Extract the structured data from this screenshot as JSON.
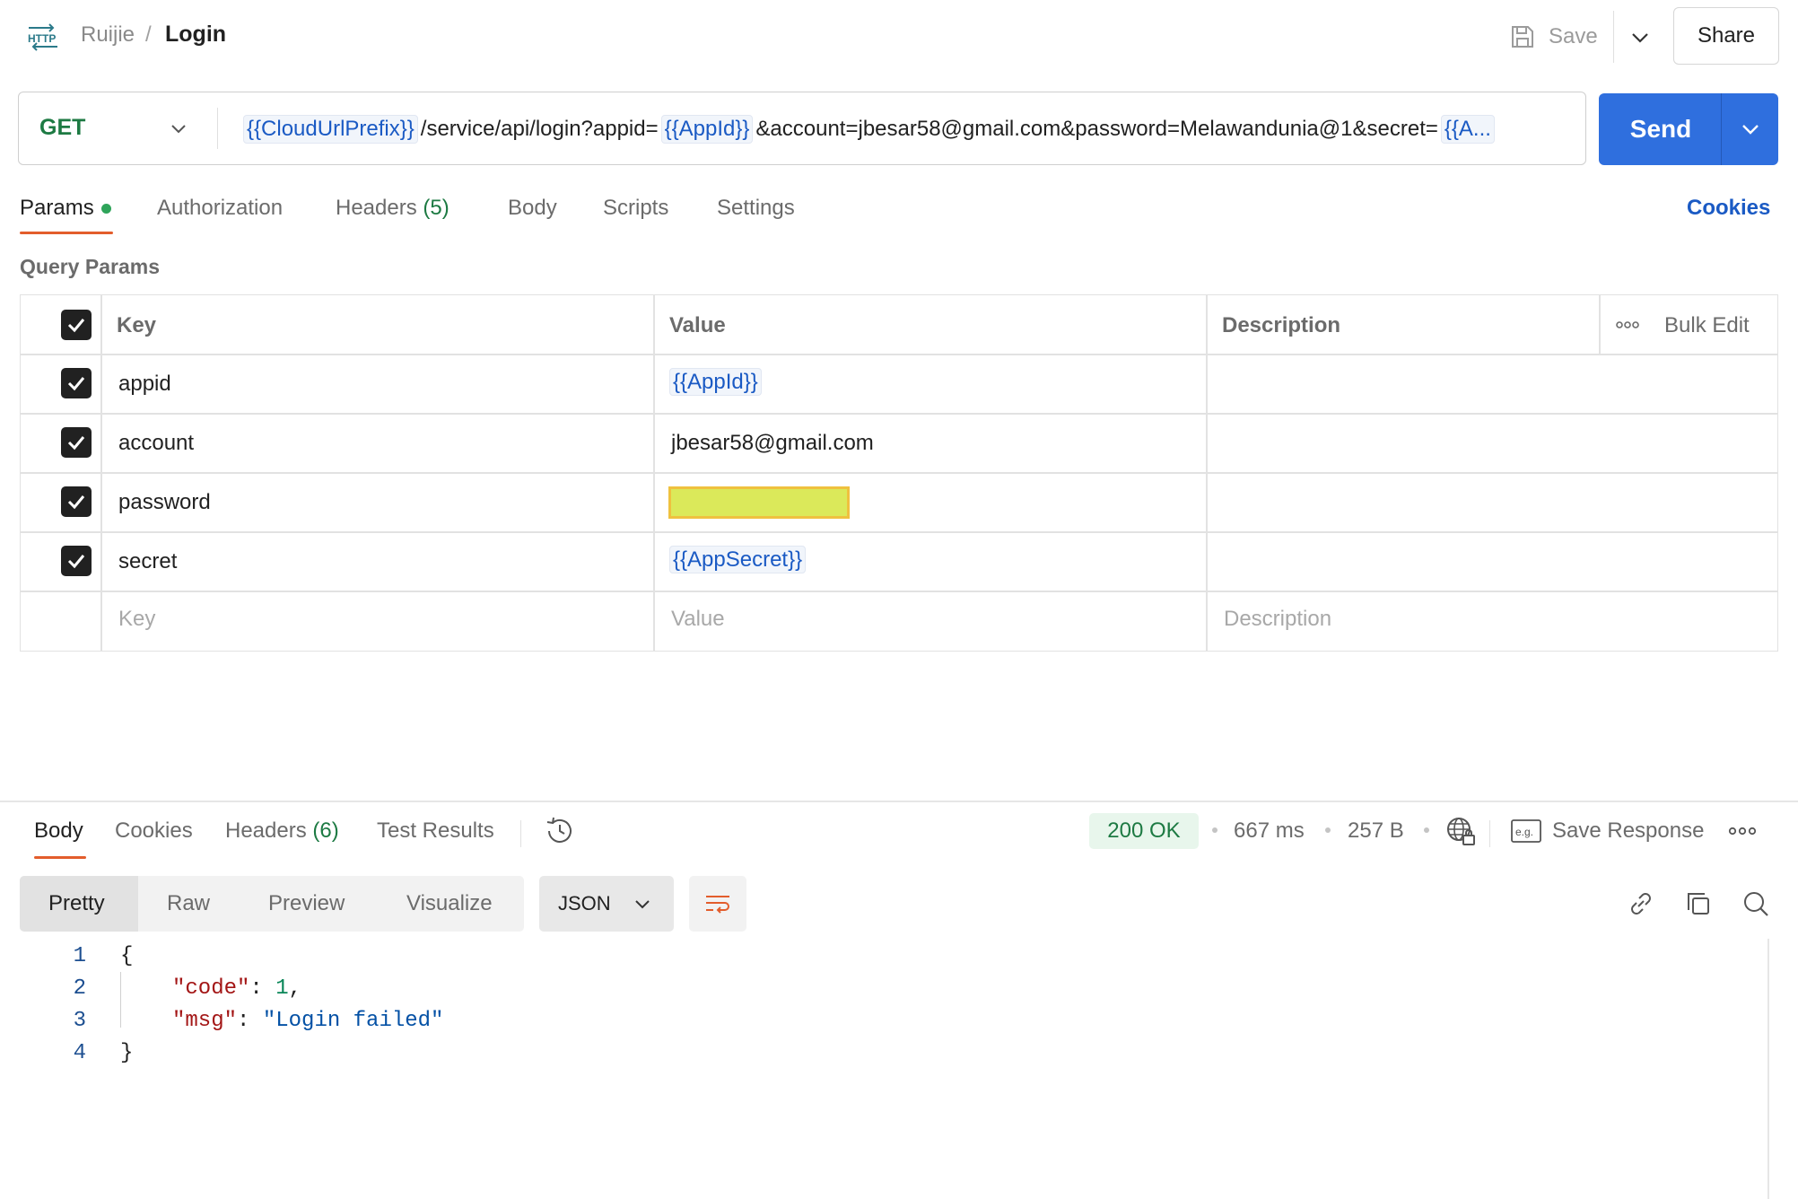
{
  "breadcrumb": {
    "parent": "Ruijie",
    "separator": "/",
    "current": "Login"
  },
  "header": {
    "save_label": "Save",
    "share_label": "Share"
  },
  "request": {
    "method": "GET",
    "url_parts": [
      {
        "type": "var",
        "text": "{{CloudUrlPrefix}}"
      },
      {
        "type": "text",
        "text": "/service/api/login?appid="
      },
      {
        "type": "var",
        "text": "{{AppId}}"
      },
      {
        "type": "text",
        "text": "&account=jbesar58@gmail.com&password=Melawandunia@1&secret="
      },
      {
        "type": "var",
        "text": "{{A..."
      }
    ],
    "send_label": "Send"
  },
  "request_tabs": {
    "params": "Params",
    "authorization": "Authorization",
    "headers": "Headers",
    "headers_count": "(5)",
    "body": "Body",
    "scripts": "Scripts",
    "settings": "Settings",
    "cookies": "Cookies"
  },
  "query_params": {
    "title": "Query Params",
    "headers": {
      "key": "Key",
      "value": "Value",
      "description": "Description",
      "bulk_edit": "Bulk Edit"
    },
    "rows": [
      {
        "key": "appid",
        "value": "{{AppId}}",
        "checked": true
      },
      {
        "key": "account",
        "value": "jbesar58@gmail.com",
        "checked": true
      },
      {
        "key": "password",
        "value": "",
        "checked": true
      },
      {
        "key": "secret",
        "value": "{{AppSecret}}",
        "checked": true
      }
    ],
    "placeholder": {
      "key": "Key",
      "value": "Value",
      "description": "Description"
    }
  },
  "response": {
    "tabs": {
      "body": "Body",
      "cookies": "Cookies",
      "headers": "Headers",
      "headers_count": "(6)",
      "test_results": "Test Results"
    },
    "status": "200 OK",
    "time": "667 ms",
    "size": "257 B",
    "save_response": "Save Response",
    "views": {
      "pretty": "Pretty",
      "raw": "Raw",
      "preview": "Preview",
      "visualize": "Visualize"
    },
    "format": "JSON",
    "code": {
      "line_numbers": [
        "1",
        "2",
        "3",
        "4"
      ],
      "open": "{",
      "key_code": "\"code\"",
      "val_code": "1",
      "key_msg": "\"msg\"",
      "val_msg": "\"Login failed\"",
      "close": "}"
    }
  },
  "colors": {
    "accent": "#e35d2c",
    "send_button": "#2f6fde",
    "method_get": "#1d7a43",
    "variable": "#1a5ac4",
    "status_ok_bg": "#e8f6ec"
  }
}
